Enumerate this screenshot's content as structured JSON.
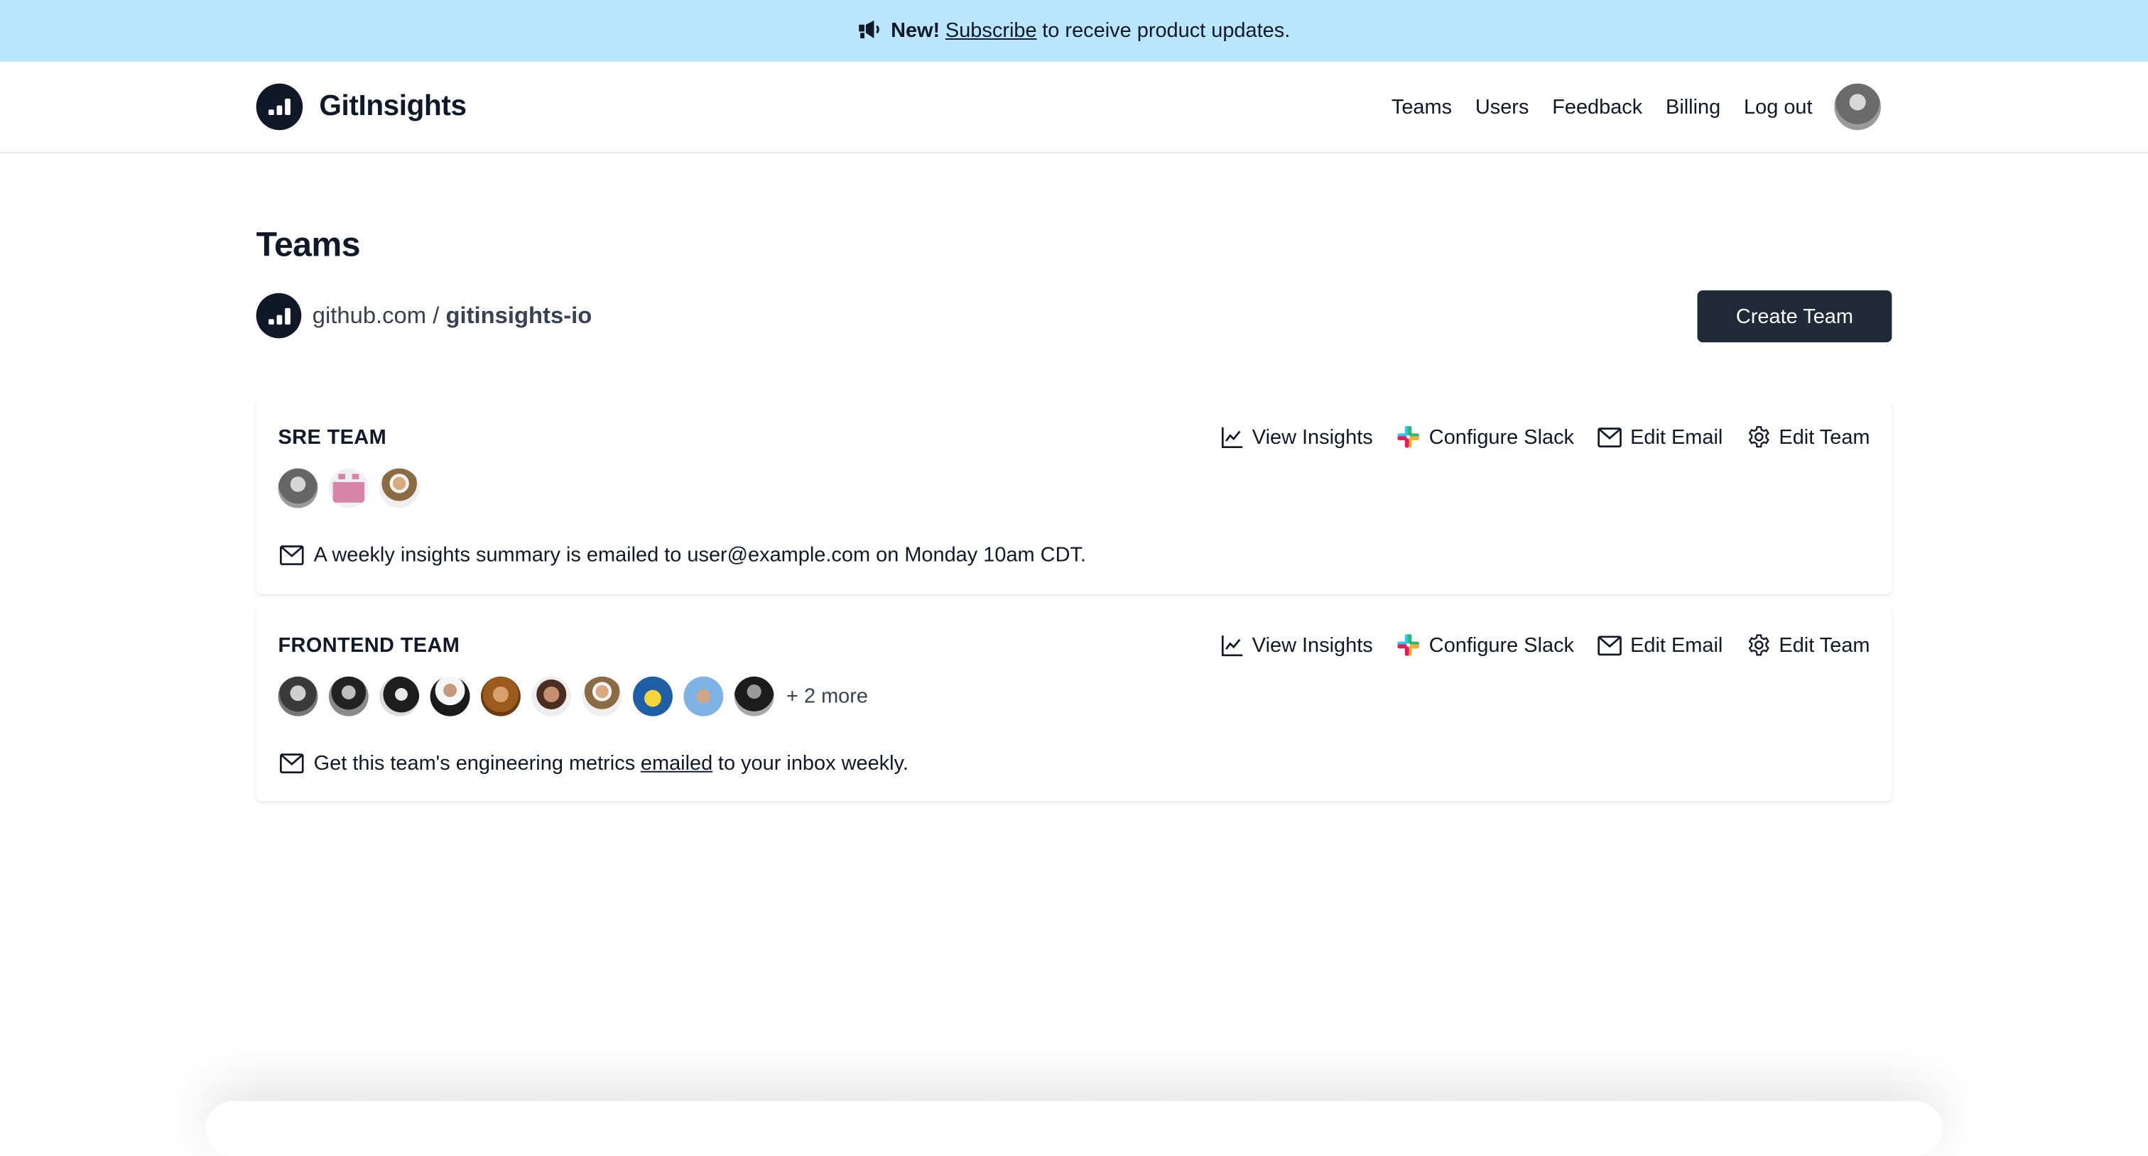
{
  "banner": {
    "icon": "megaphone-icon",
    "new_label": "New!",
    "link_label": "Subscribe",
    "text": "to receive product updates.",
    "background": "#bae6fd"
  },
  "header": {
    "app_name": "GitInsights",
    "nav": [
      {
        "label": "Teams"
      },
      {
        "label": "Users"
      },
      {
        "label": "Feedback"
      },
      {
        "label": "Billing"
      },
      {
        "label": "Log out"
      }
    ]
  },
  "page": {
    "title": "Teams",
    "org_host": "github.com /",
    "org_name": "gitinsights-io",
    "create_button": "Create Team",
    "accent": "#1f2937"
  },
  "teams": [
    {
      "name": "SRE TEAM",
      "actions": [
        "View Insights",
        "Configure Slack",
        "Edit Email",
        "Edit Team"
      ],
      "members_shown": 3,
      "more": "",
      "note": "A weekly insights summary is emailed to user@example.com on Monday 10am CDT."
    },
    {
      "name": "FRONTEND TEAM",
      "actions": [
        "View Insights",
        "Configure Slack",
        "Edit Email",
        "Edit Team"
      ],
      "members_shown": 10,
      "more": "+ 2 more",
      "note_before": "Get this team's engineering metrics",
      "note_link": "emailed",
      "note_after": "to your inbox weekly."
    }
  ]
}
